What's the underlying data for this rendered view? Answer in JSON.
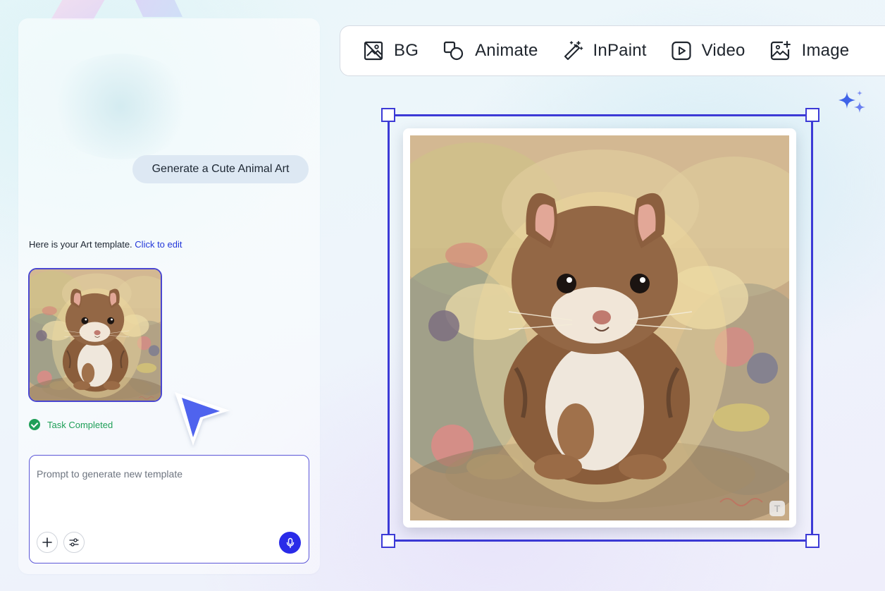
{
  "chat": {
    "user_message": "Generate a Cute Animal Art",
    "assistant_text": "Here is your Art template.",
    "assistant_link": "Click to edit",
    "thumbnail_alt": "squirrel-painting-thumbnail",
    "status": "Task Completed",
    "prompt_placeholder": "Prompt to generate new template"
  },
  "toolbar": {
    "tools": [
      {
        "label": "BG",
        "icon": "remove-bg-icon"
      },
      {
        "label": "Animate",
        "icon": "animate-icon"
      },
      {
        "label": "InPaint",
        "icon": "magic-wand-icon"
      },
      {
        "label": "Video",
        "icon": "play-icon"
      },
      {
        "label": "Image",
        "icon": "image-add-icon"
      }
    ]
  },
  "canvas": {
    "watermark_letter": "T"
  },
  "colors": {
    "accent": "#3c3ad6",
    "mic_button": "#2a2be8",
    "success": "#1f9f58",
    "link": "#2337d9"
  }
}
